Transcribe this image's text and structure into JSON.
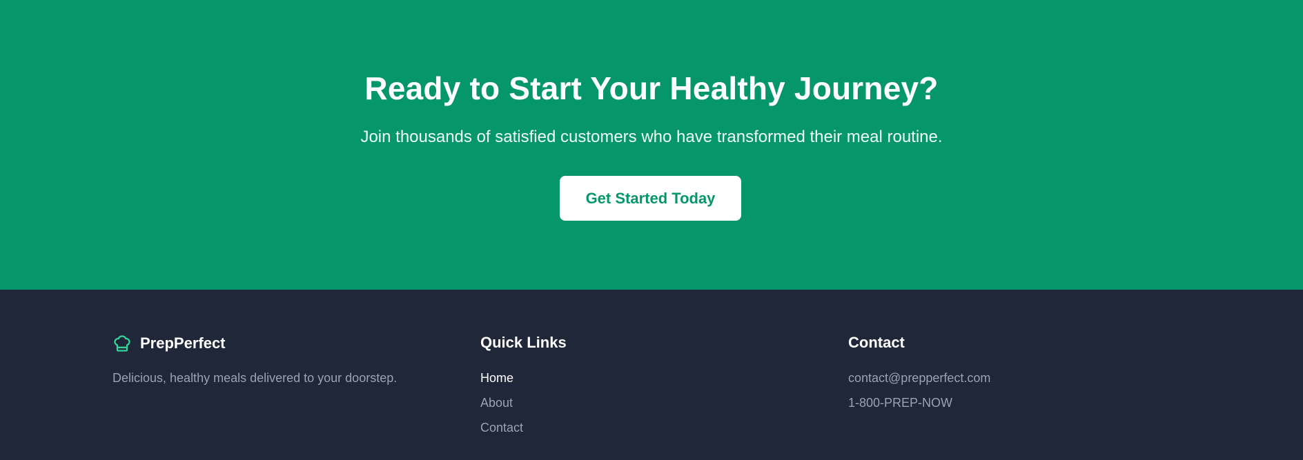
{
  "cta": {
    "title": "Ready to Start Your Healthy Journey?",
    "subtitle": "Join thousands of satisfied customers who have transformed their meal routine.",
    "button_label": "Get Started Today"
  },
  "footer": {
    "brand": {
      "name": "PrepPerfect",
      "icon": "chef-hat-icon",
      "tagline": "Delicious, healthy meals delivered to your doorstep."
    },
    "quick_links": {
      "heading": "Quick Links",
      "items": [
        {
          "label": "Home",
          "active": true
        },
        {
          "label": "About",
          "active": false
        },
        {
          "label": "Contact",
          "active": false
        }
      ]
    },
    "contact": {
      "heading": "Contact",
      "email": "contact@prepperfect.com",
      "phone": "1-800-PREP-NOW"
    }
  },
  "colors": {
    "cta_background": "#059669",
    "footer_background": "#1f2738",
    "brand_icon": "#34d399",
    "muted_text": "#9aa3b2"
  }
}
